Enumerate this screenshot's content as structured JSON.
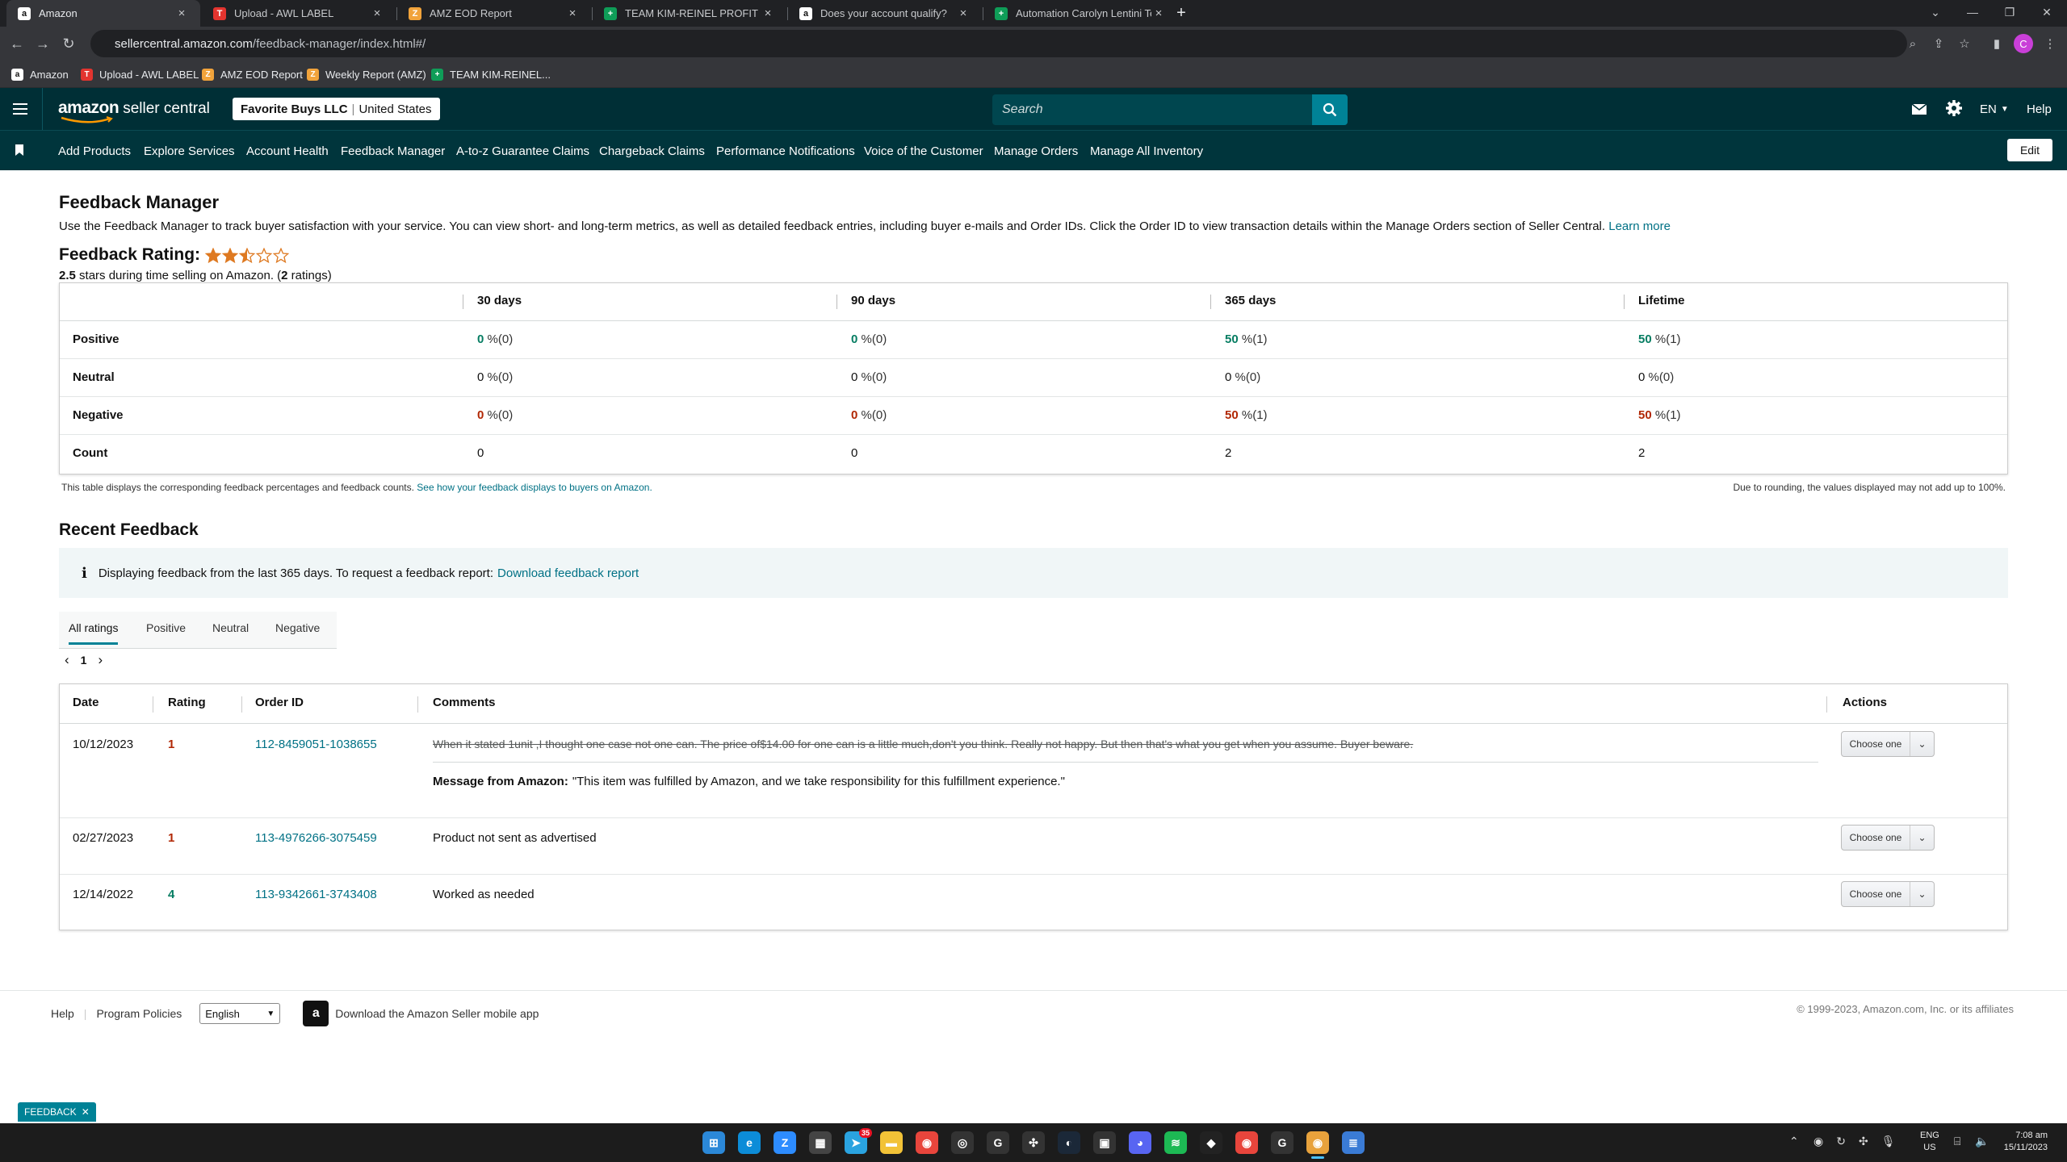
{
  "browser": {
    "tabs": [
      {
        "title": "Amazon",
        "active": true,
        "favicon_color": "#ffffff",
        "favicon_text": "a"
      },
      {
        "title": "Upload - AWL LABEL",
        "active": false,
        "favicon_color": "#e3342f",
        "favicon_text": "T"
      },
      {
        "title": "AMZ EOD Report",
        "active": false,
        "favicon_color": "#f1a33b",
        "favicon_text": "Z"
      },
      {
        "title": "TEAM KIM-REINEL PROFIT SHEE",
        "active": false,
        "favicon_color": "#0f9d58",
        "favicon_text": "+"
      },
      {
        "title": "Does your account qualify?",
        "active": false,
        "favicon_color": "#ffffff",
        "favicon_text": "a"
      },
      {
        "title": "Automation Carolyn Lentini Tea",
        "active": false,
        "favicon_color": "#0f9d58",
        "favicon_text": "+"
      }
    ],
    "url_host": "sellercentral.amazon.com",
    "url_path": "/feedback-manager/index.html#/",
    "bookmarks": [
      {
        "label": "Amazon",
        "favicon_color": "#ffffff",
        "favicon_text": "a"
      },
      {
        "label": "Upload - AWL LABEL",
        "favicon_color": "#e3342f",
        "favicon_text": "T"
      },
      {
        "label": "AMZ EOD Report",
        "favicon_color": "#f1a33b",
        "favicon_text": "Z"
      },
      {
        "label": "Weekly Report (AMZ)",
        "favicon_color": "#f1a33b",
        "favicon_text": "Z"
      },
      {
        "label": "TEAM KIM-REINEL...",
        "favicon_color": "#0f9d58",
        "favicon_text": "+"
      }
    ],
    "profile_initial": "C"
  },
  "header": {
    "logo_amazon": "amazon",
    "logo_seller": "seller central",
    "store_name": "Favorite Buys LLC",
    "store_region": "United States",
    "search_placeholder": "Search",
    "language": "EN",
    "help": "Help"
  },
  "nav": {
    "items": [
      "Add Products",
      "Explore Services",
      "Account Health",
      "Feedback Manager",
      "A-to-z Guarantee Claims",
      "Chargeback Claims",
      "Performance Notifications",
      "Voice of the Customer",
      "Manage Orders",
      "Manage All Inventory"
    ],
    "edit": "Edit"
  },
  "page": {
    "title": "Feedback Manager",
    "description": "Use the Feedback Manager to track buyer satisfaction with your service. You can view short- and long-term metrics, as well as detailed feedback entries, including buyer e-mails and Order IDs. Click the Order ID to view transaction details within the Manage Orders section of Seller Central.",
    "learn_more": "Learn more",
    "rating_label": "Feedback Rating:",
    "rating_stars": 2.5,
    "rating_value": "2.5",
    "rating_text_mid": "stars during time selling on Amazon. (",
    "rating_count": "2",
    "rating_text_end": "ratings)"
  },
  "summary": {
    "columns": [
      "30 days",
      "90 days",
      "365 days",
      "Lifetime"
    ],
    "rows": [
      {
        "label": "Positive",
        "kind": "positive",
        "cells": [
          {
            "v": "0",
            "c": "(0)"
          },
          {
            "v": "0",
            "c": "(0)"
          },
          {
            "v": "50",
            "c": "(1)"
          },
          {
            "v": "50",
            "c": "(1)"
          }
        ]
      },
      {
        "label": "Neutral",
        "kind": "neutral",
        "cells": [
          {
            "v": "0",
            "c": "(0)"
          },
          {
            "v": "0",
            "c": "(0)"
          },
          {
            "v": "0",
            "c": "(0)"
          },
          {
            "v": "0",
            "c": "(0)"
          }
        ]
      },
      {
        "label": "Negative",
        "kind": "negative",
        "cells": [
          {
            "v": "0",
            "c": "(0)"
          },
          {
            "v": "0",
            "c": "(0)"
          },
          {
            "v": "50",
            "c": "(1)"
          },
          {
            "v": "50",
            "c": "(1)"
          }
        ]
      }
    ],
    "count_label": "Count",
    "counts": [
      "0",
      "0",
      "2",
      "2"
    ],
    "footnote": "This table displays the corresponding feedback percentages and feedback counts.",
    "footnote_link": "See how your feedback displays to buyers on Amazon.",
    "rounding_note": "Due to rounding, the values displayed may not add up to 100%."
  },
  "recent": {
    "title": "Recent Feedback",
    "info_text": "Displaying feedback from the last 365 days. To request a feedback report:",
    "info_link": "Download feedback report",
    "tabs": [
      "All ratings",
      "Positive",
      "Neutral",
      "Negative"
    ],
    "page": "1",
    "columns": [
      "Date",
      "Rating",
      "Order ID",
      "Comments",
      "Actions"
    ],
    "rows": [
      {
        "date": "10/12/2023",
        "rating": "1",
        "order_id": "112-8459051-1038655",
        "comment": "When it stated 1unit ,I thought one case not one can. The price of$14.00 for one can is a little much,don't you think. Really not happy. But then that's what you get when you assume. Buyer beware.",
        "struck": true,
        "amazon_label": "Message from Amazon:",
        "amazon_msg": "\"This item was fulfilled by Amazon, and we take responsibility for this fulfillment experience.\"",
        "action": "Choose one"
      },
      {
        "date": "02/27/2023",
        "rating": "1",
        "order_id": "113-4976266-3075459",
        "comment": "Product not sent as advertised",
        "struck": false,
        "action": "Choose one"
      },
      {
        "date": "12/14/2022",
        "rating": "4",
        "order_id": "113-9342661-3743408",
        "comment": "Worked as needed",
        "struck": false,
        "action": "Choose one"
      }
    ]
  },
  "footer": {
    "links": [
      "Help",
      "Program Policies"
    ],
    "language": "English",
    "app_text": "Download the Amazon Seller mobile app",
    "copyright": "© 1999-2023, Amazon.com, Inc. or its affiliates",
    "feedback_tab": "FEEDBACK"
  },
  "taskbar": {
    "lang": "ENG",
    "region": "US",
    "time": "7:08 am",
    "date": "15/11/2023",
    "telegram_badge": "35"
  },
  "colors": {
    "header_bg": "#002f36",
    "nav_bg": "#00353c",
    "accent": "#008296",
    "link": "#007185",
    "positive": "#067d62",
    "negative": "#b12704",
    "star": "#de7921"
  }
}
